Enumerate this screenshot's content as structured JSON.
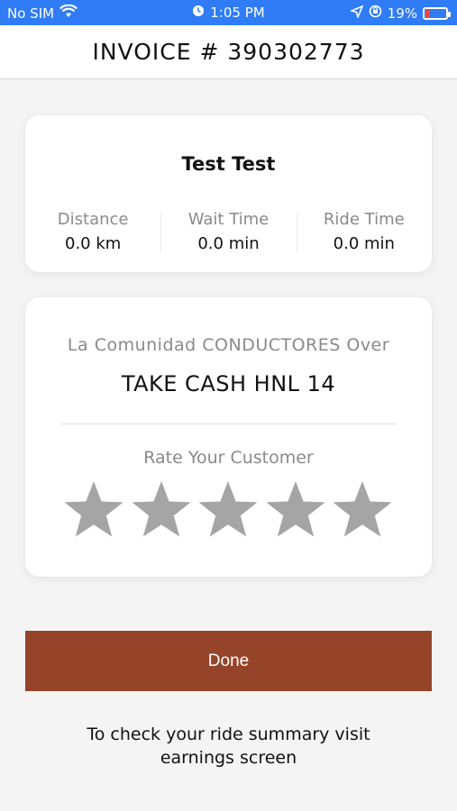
{
  "status_bar": {
    "carrier": "No SIM",
    "time": "1:05 PM",
    "battery": "19%",
    "icons": [
      "wifi-icon",
      "alarm-icon",
      "location-icon",
      "orientation-lock-icon",
      "battery-icon"
    ],
    "battery_level": 0.19
  },
  "header": {
    "title": "INVOICE # 390302773"
  },
  "trip": {
    "customer_name": "Test Test",
    "stats": [
      {
        "label": "Distance",
        "value": "0.0 km"
      },
      {
        "label": "Wait Time",
        "value": "0.0 min"
      },
      {
        "label": "Ride Time",
        "value": "0.0 min"
      }
    ]
  },
  "payment": {
    "company": "La Comunidad CONDUCTORES Over",
    "amount_text": "TAKE CASH HNL 14",
    "rate_label": "Rate Your Customer",
    "rating": 0,
    "max_rating": 5
  },
  "actions": {
    "done_label": "Done"
  },
  "footer": {
    "note": "To check your ride summary visit earnings screen"
  },
  "colors": {
    "status_bar": "#2f7cf6",
    "accent_button": "#95442a",
    "star_empty": "#a5a5a5"
  }
}
